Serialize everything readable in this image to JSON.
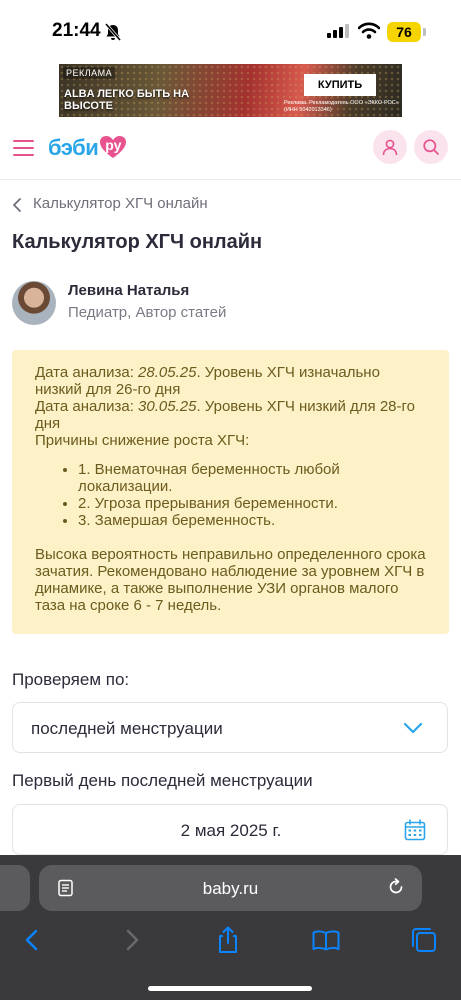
{
  "status_bar": {
    "time": "21:44",
    "battery": "76"
  },
  "ad": {
    "tag": "РЕКЛАМА",
    "headline": "ALBA ЛЕГКО БЫТЬ НА ВЫСОТЕ",
    "button": "КУПИТЬ",
    "legal": "Реклама. Рекламодатель ООО «ЭККО-РОС» (ИНН 5042013346)"
  },
  "header": {
    "logo_text": "бэби",
    "logo_badge": "ру"
  },
  "breadcrumb": {
    "label": "Калькулятор ХГЧ онлайн"
  },
  "page": {
    "title": "Калькулятор ХГЧ онлайн"
  },
  "author": {
    "name": "Левина Наталья",
    "role": "Педиатр, Автор статей"
  },
  "result": {
    "line1_prefix": "Дата анализа: ",
    "line1_date": "28.05.25",
    "line1_suffix": ". Уровень ХГЧ изначально низкий для 26-го дня",
    "line2_prefix": "Дата анализа: ",
    "line2_date": "30.05.25",
    "line2_suffix": ". Уровень ХГЧ низкий для 28-го дня",
    "causes_title": "Причины снижение роста ХГЧ:",
    "causes": [
      "1. Внематочная беременность любой локализации.",
      "2. Угроза прерывания беременности.",
      "3. Замершая беременность."
    ],
    "conclusion": "Высока вероятность неправильно определенного срока зачатия. Рекомендовано наблюдение за уровнем ХГЧ в динамике, а также выполнение УЗИ органов малого таза на сроке 6 - 7 недель."
  },
  "form": {
    "check_by_label": "Проверяем по:",
    "check_by_value": "последней менструации",
    "date_label": "Первый день последней менструации",
    "date_value": "2 мая 2025 г."
  },
  "browser": {
    "url": "baby.ru"
  },
  "colors": {
    "brand_pink": "#e8538f",
    "brand_blue": "#2aa6e8",
    "result_bg": "#fdf1c8",
    "result_text": "#6b5c1d",
    "ios_blue": "#0a84ff"
  },
  "icons": [
    "bell-muted-icon",
    "signal-icon",
    "wifi-icon",
    "menu-icon",
    "profile-icon",
    "search-icon",
    "chevron-left-icon",
    "chevron-down-icon",
    "calendar-icon",
    "reader-icon",
    "reload-icon",
    "back-icon",
    "forward-icon",
    "share-icon",
    "bookmarks-icon",
    "tabs-icon"
  ]
}
